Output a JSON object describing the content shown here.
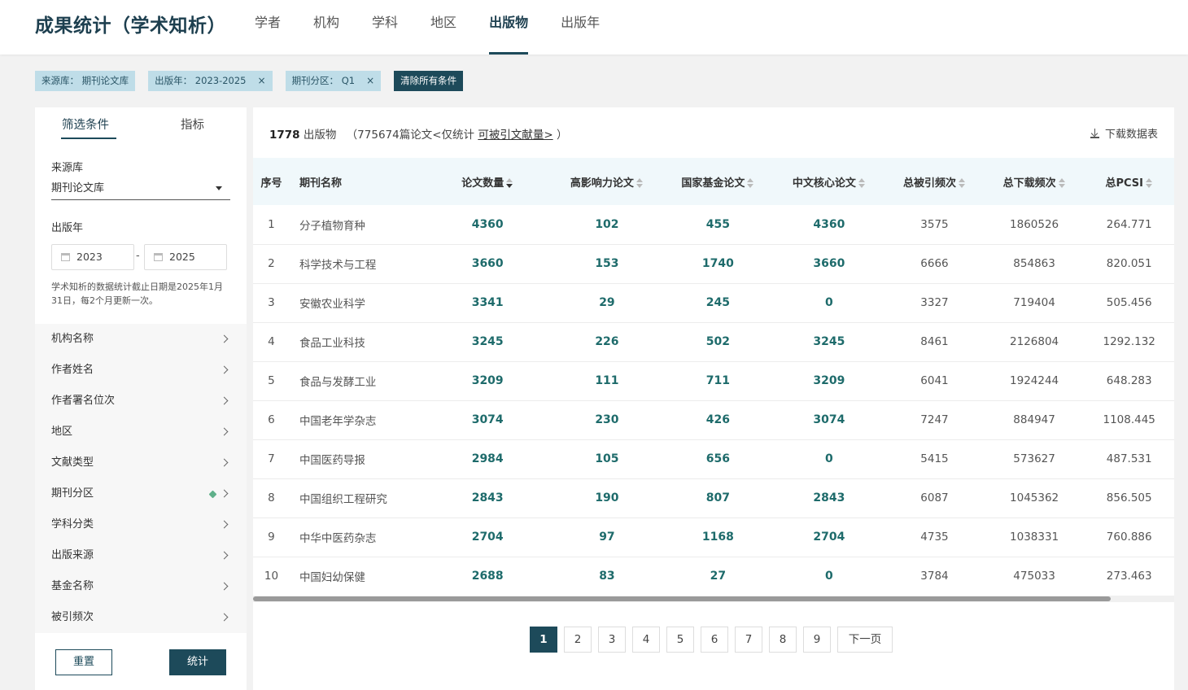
{
  "header": {
    "title": "成果统计（学术知析）",
    "tabs": [
      {
        "label": "学者",
        "active": false
      },
      {
        "label": "机构",
        "active": false
      },
      {
        "label": "学科",
        "active": false
      },
      {
        "label": "地区",
        "active": false
      },
      {
        "label": "出版物",
        "active": true
      },
      {
        "label": "出版年",
        "active": false
      }
    ]
  },
  "chips": {
    "items": [
      {
        "label": "来源库：  期刊论文库"
      },
      {
        "label": "出版年：  2023-2025",
        "close": "×"
      },
      {
        "label": "期刊分区：  Q1",
        "close": "×"
      }
    ],
    "clear_label": "清除所有条件"
  },
  "sidebar": {
    "tab_filter": "筛选条件",
    "tab_metric": "指标",
    "source_label": "来源库",
    "source_value": "期刊论文库",
    "year_label": "出版年",
    "year_from": "2023",
    "year_to": "2025",
    "year_sep": "-",
    "note": "学术知析的数据统计截止日期是2025年1月31日，每2个月更新一次。",
    "facets": [
      "机构名称",
      "作者姓名",
      "作者署名位次",
      "地区",
      "文献类型",
      "期刊分区",
      "学科分类",
      "出版来源",
      "基金名称",
      "被引频次"
    ],
    "reset_label": "重置",
    "stat_label": "统计"
  },
  "summary": {
    "count": "1778",
    "unit": "出版物",
    "detail": "（775674篇论文<仅统计",
    "link": "可被引文献量>",
    "tail": "）",
    "download_label": "下载数据表"
  },
  "table": {
    "headers": [
      "序号",
      "期刊名称",
      "论文数量",
      "高影响力论文",
      "国家基金论文",
      "中文核心论文",
      "总被引频次",
      "总下载频次",
      "总PCSI"
    ],
    "rows": [
      [
        "1",
        "分子植物育种",
        "4360",
        "102",
        "455",
        "4360",
        "3575",
        "1860526",
        "264.771"
      ],
      [
        "2",
        "科学技术与工程",
        "3660",
        "153",
        "1740",
        "3660",
        "6666",
        "854863",
        "820.051"
      ],
      [
        "3",
        "安徽农业科学",
        "3341",
        "29",
        "245",
        "0",
        "3327",
        "719404",
        "505.456"
      ],
      [
        "4",
        "食品工业科技",
        "3245",
        "226",
        "502",
        "3245",
        "8461",
        "2126804",
        "1292.132"
      ],
      [
        "5",
        "食品与发酵工业",
        "3209",
        "111",
        "711",
        "3209",
        "6041",
        "1924244",
        "648.283"
      ],
      [
        "6",
        "中国老年学杂志",
        "3074",
        "230",
        "426",
        "3074",
        "7247",
        "884947",
        "1108.445"
      ],
      [
        "7",
        "中国医药导报",
        "2984",
        "105",
        "656",
        "0",
        "5415",
        "573627",
        "487.531"
      ],
      [
        "8",
        "中国组织工程研究",
        "2843",
        "190",
        "807",
        "2843",
        "6087",
        "1045362",
        "856.505"
      ],
      [
        "9",
        "中华中医药杂志",
        "2704",
        "97",
        "1168",
        "2704",
        "4735",
        "1038331",
        "760.886"
      ],
      [
        "10",
        "中国妇幼保健",
        "2688",
        "83",
        "27",
        "0",
        "3784",
        "475033",
        "273.463"
      ]
    ]
  },
  "pagination": {
    "pages": [
      "1",
      "2",
      "3",
      "4",
      "5",
      "6",
      "7",
      "8",
      "9"
    ],
    "current": "1",
    "next_label": "下一页"
  }
}
